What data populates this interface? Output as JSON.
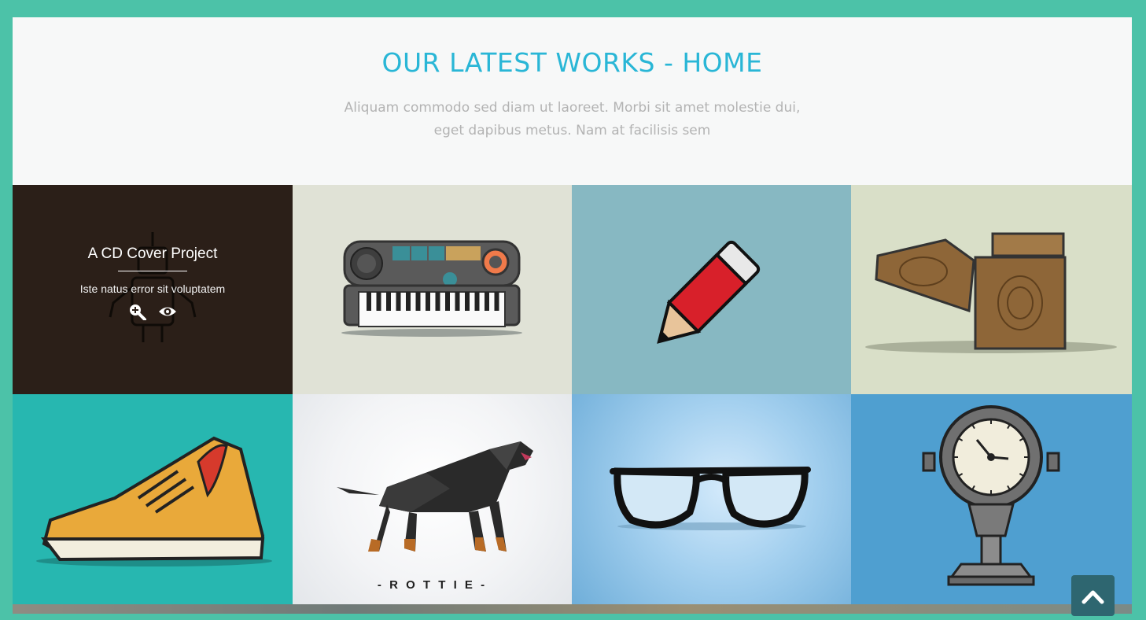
{
  "section": {
    "title": "OUR LATEST WORKS - HOME",
    "subtitle": "Aliquam commodo sed diam ut laoreet. Morbi sit amet molestie dui, eget dapibus metus. Nam at facilisis sem"
  },
  "portfolio": {
    "active_item": {
      "title": "A CD Cover Project",
      "description": "Iste natus error sit voluptatem",
      "zoom_icon": "zoom-in-icon",
      "view_icon": "eye-icon"
    },
    "rottie_label": "- R O T T I E -",
    "items": [
      {
        "name": "robot-cd-cover",
        "bg": "#2b1f18"
      },
      {
        "name": "keyboard-synth",
        "bg": "#e0e2d6"
      },
      {
        "name": "red-pencil",
        "bg": "#87b8c2"
      },
      {
        "name": "wooden-lighter",
        "bg": "#d9dfc8"
      },
      {
        "name": "yellow-sneaker",
        "bg": "#27b7b0"
      },
      {
        "name": "rottie-dog",
        "bg": "#eef0f2"
      },
      {
        "name": "black-glasses",
        "bg": "#8ec0e2"
      },
      {
        "name": "pressure-gauge",
        "bg": "#4f9fd0"
      }
    ]
  },
  "scroll_top_icon": "chevron-up-icon"
}
